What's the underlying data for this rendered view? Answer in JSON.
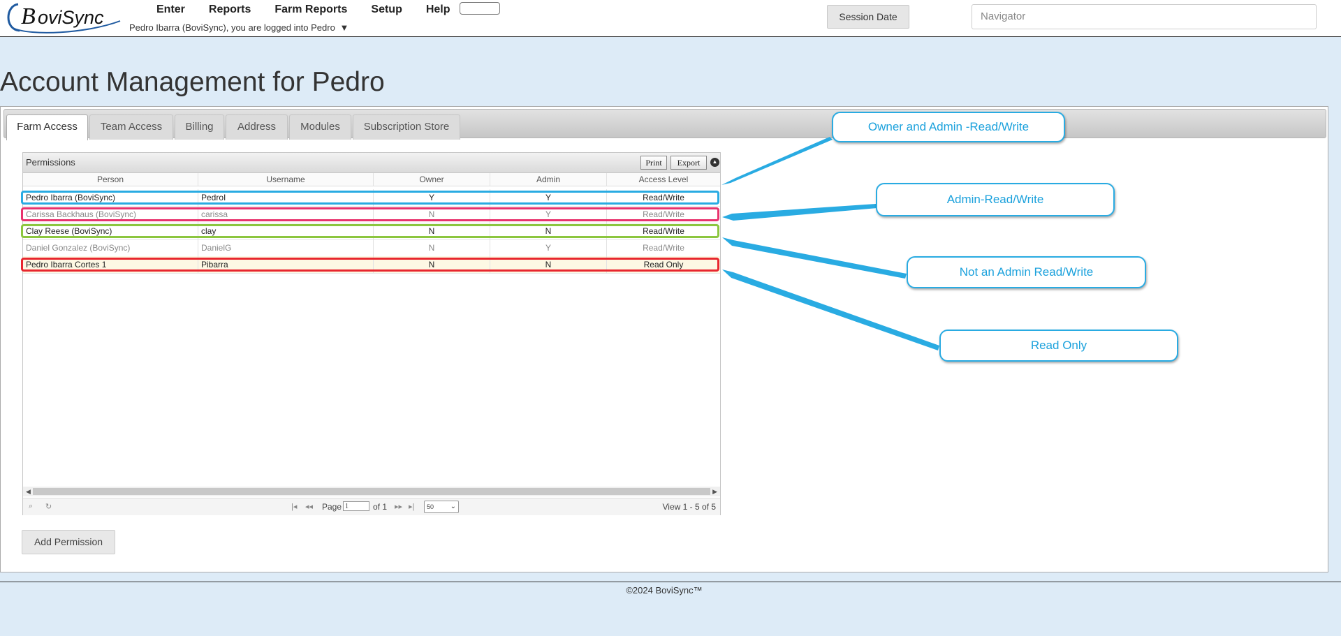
{
  "app": {
    "logo_text": "BoviSync",
    "menu": [
      "Enter",
      "Reports",
      "Farm Reports",
      "Setup",
      "Help"
    ],
    "login_text": "Pedro Ibarra (BoviSync), you are logged into Pedro",
    "login_caret": "▼",
    "session_button": "Session Date",
    "navigator_placeholder": "Navigator"
  },
  "page": {
    "title": "Account Management for Pedro",
    "tabs": [
      "Farm Access",
      "Team Access",
      "Billing",
      "Address",
      "Modules",
      "Subscription Store"
    ],
    "active_tab": "Farm Access"
  },
  "grid": {
    "caption": "Permissions",
    "print_label": "Print",
    "export_label": "Export",
    "columns": [
      "Person",
      "Username",
      "Owner",
      "Admin",
      "Access Level"
    ],
    "rows": [
      {
        "person": "Pedro Ibarra (BoviSync)",
        "username": "PedroI",
        "owner": "Y",
        "admin": "Y",
        "access": "Read/Write"
      },
      {
        "person": "Carissa Backhaus (BoviSync)",
        "username": "carissa",
        "owner": "N",
        "admin": "Y",
        "access": "Read/Write"
      },
      {
        "person": "Clay Reese (BoviSync)",
        "username": "clay",
        "owner": "N",
        "admin": "N",
        "access": "Read/Write"
      },
      {
        "person": "Daniel Gonzalez (BoviSync)",
        "username": "DanielG",
        "owner": "N",
        "admin": "Y",
        "access": "Read/Write"
      },
      {
        "person": "Pedro Ibarra Cortes 1",
        "username": "Pibarra",
        "owner": "N",
        "admin": "N",
        "access": "Read Only"
      }
    ],
    "pager": {
      "page_label": "Page",
      "page_value": "1",
      "of_label": "of 1",
      "rows_per_page": "50",
      "view_label": "View 1 - 5 of 5"
    }
  },
  "add_permission_label": "Add Permission",
  "annotations": {
    "owner_admin": "Owner and Admin -Read/Write",
    "admin": "Admin-Read/Write",
    "not_admin": "Not an Admin Read/Write",
    "read_only": "Read Only"
  },
  "outline_colors": {
    "owner_admin": "#29abe2",
    "admin": "#e8336d",
    "not_admin": "#8cc63f",
    "read_only": "#e8262e"
  },
  "footer": "©2024 BoviSync™"
}
